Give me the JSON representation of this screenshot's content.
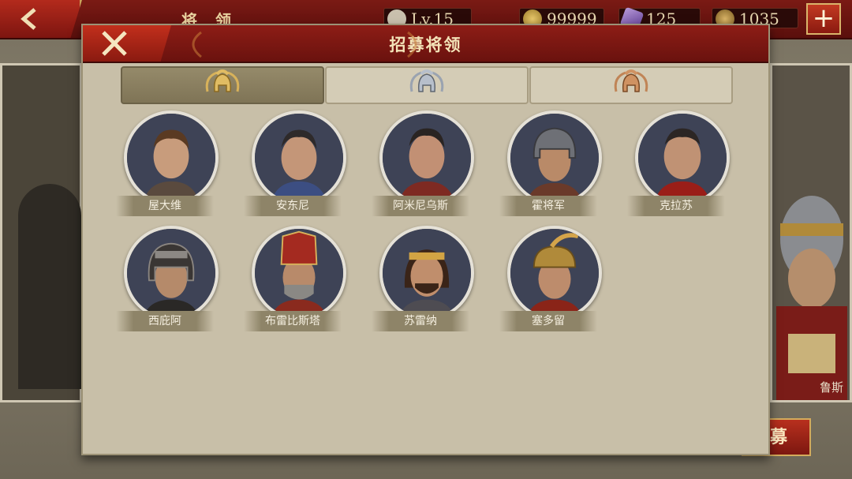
{
  "topbar": {
    "title": "将 领",
    "level": "Lv.15",
    "gold": "99999",
    "gems": "125",
    "laurels": "1035"
  },
  "background": {
    "right_hero_name": "鲁斯",
    "recruit_button_label": "募"
  },
  "modal": {
    "title": "招募将领",
    "tabs": [
      {
        "icon": "gold-helmet-icon",
        "active": true
      },
      {
        "icon": "silver-helmet-icon",
        "active": false
      },
      {
        "icon": "bronze-helmet-icon",
        "active": false
      }
    ],
    "heroes": [
      {
        "name": "屋大维"
      },
      {
        "name": "安东尼"
      },
      {
        "name": "阿米尼乌斯"
      },
      {
        "name": "霍将军"
      },
      {
        "name": "克拉苏"
      },
      {
        "name": "西庇阿"
      },
      {
        "name": "布雷比斯塔"
      },
      {
        "name": "苏雷纳"
      },
      {
        "name": "塞多留"
      }
    ]
  },
  "colors": {
    "header_red": "#7a1a14",
    "panel": "#c8bfa8",
    "gold": "#c9a35a"
  }
}
